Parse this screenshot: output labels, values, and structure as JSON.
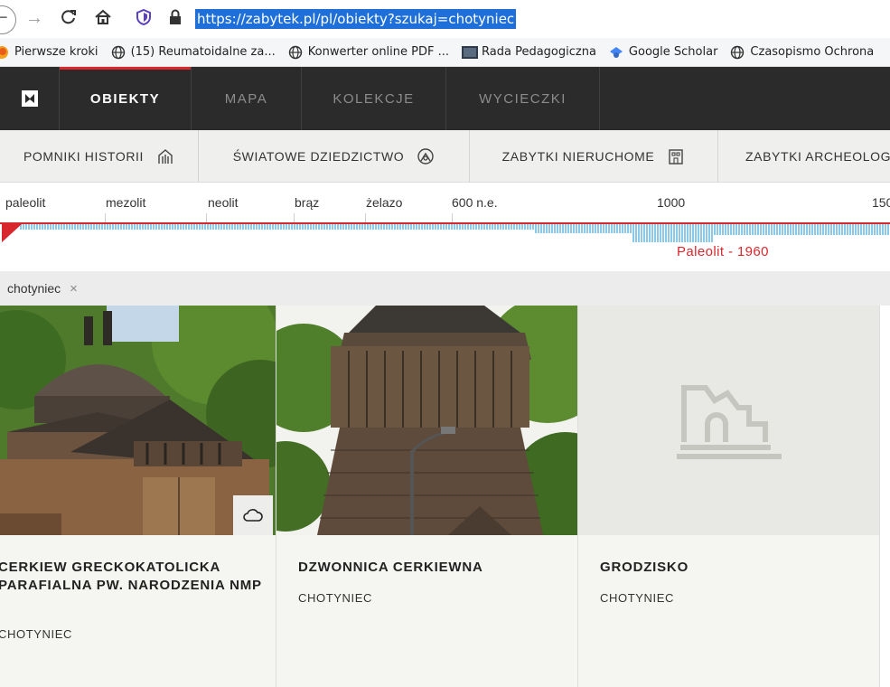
{
  "browser": {
    "url": "https://zabytek.pl/pl/obiekty?szukaj=chotyniec",
    "bookmarks": [
      {
        "label": "Pierwsze kroki",
        "icon": "firefox-icon"
      },
      {
        "label": "(15) Reumatoidalne za...",
        "icon": "globe-icon"
      },
      {
        "label": "Konwerter online PDF ...",
        "icon": "globe-icon"
      },
      {
        "label": "Rada Pedagogiczna",
        "icon": "bookmark-page-icon"
      },
      {
        "label": "Google Scholar",
        "icon": "scholar-icon"
      },
      {
        "label": "Czasopismo Ochrona",
        "icon": "globe-icon"
      }
    ]
  },
  "nav": {
    "items": [
      {
        "label": "OBIEKTY",
        "active": true
      },
      {
        "label": "MAPA",
        "active": false
      },
      {
        "label": "KOLEKCJE",
        "active": false
      },
      {
        "label": "WYCIECZKI",
        "active": false
      }
    ]
  },
  "categories": [
    {
      "label": "POMNIKI HISTORII",
      "icon": "monument-icon"
    },
    {
      "label": "ŚWIATOWE DZIEDZICTWO",
      "icon": "world-heritage-icon"
    },
    {
      "label": "ZABYTKI NIERUCHOME",
      "icon": "building-icon"
    },
    {
      "label": "ZABYTKI ARCHEOLOG",
      "icon": "archaeology-icon"
    }
  ],
  "timeline": {
    "labels": [
      "paleolit",
      "mezolit",
      "neolit",
      "brąz",
      "żelazo",
      "600 n.e.",
      "1000",
      "150"
    ],
    "range_label": "Paleolit - 1960",
    "accent_color": "#d9272e",
    "bar_color": "#8cc8e8"
  },
  "filter": {
    "chip_label": "chotyniec",
    "remove_symbol": "×"
  },
  "cards": [
    {
      "title": "CERKIEW GRECKOKATOLICKA PARAFIALNA PW. NARODZENIA NMP",
      "place": "CHOTYNIEC",
      "photo": "wooden-church"
    },
    {
      "title": "DZWONNICA CERKIEWNA",
      "place": "CHOTYNIEC",
      "photo": "wooden-bell-tower"
    },
    {
      "title": "GRODZISKO",
      "place": "CHOTYNIEC",
      "photo": "placeholder-ruin-icon"
    }
  ]
}
